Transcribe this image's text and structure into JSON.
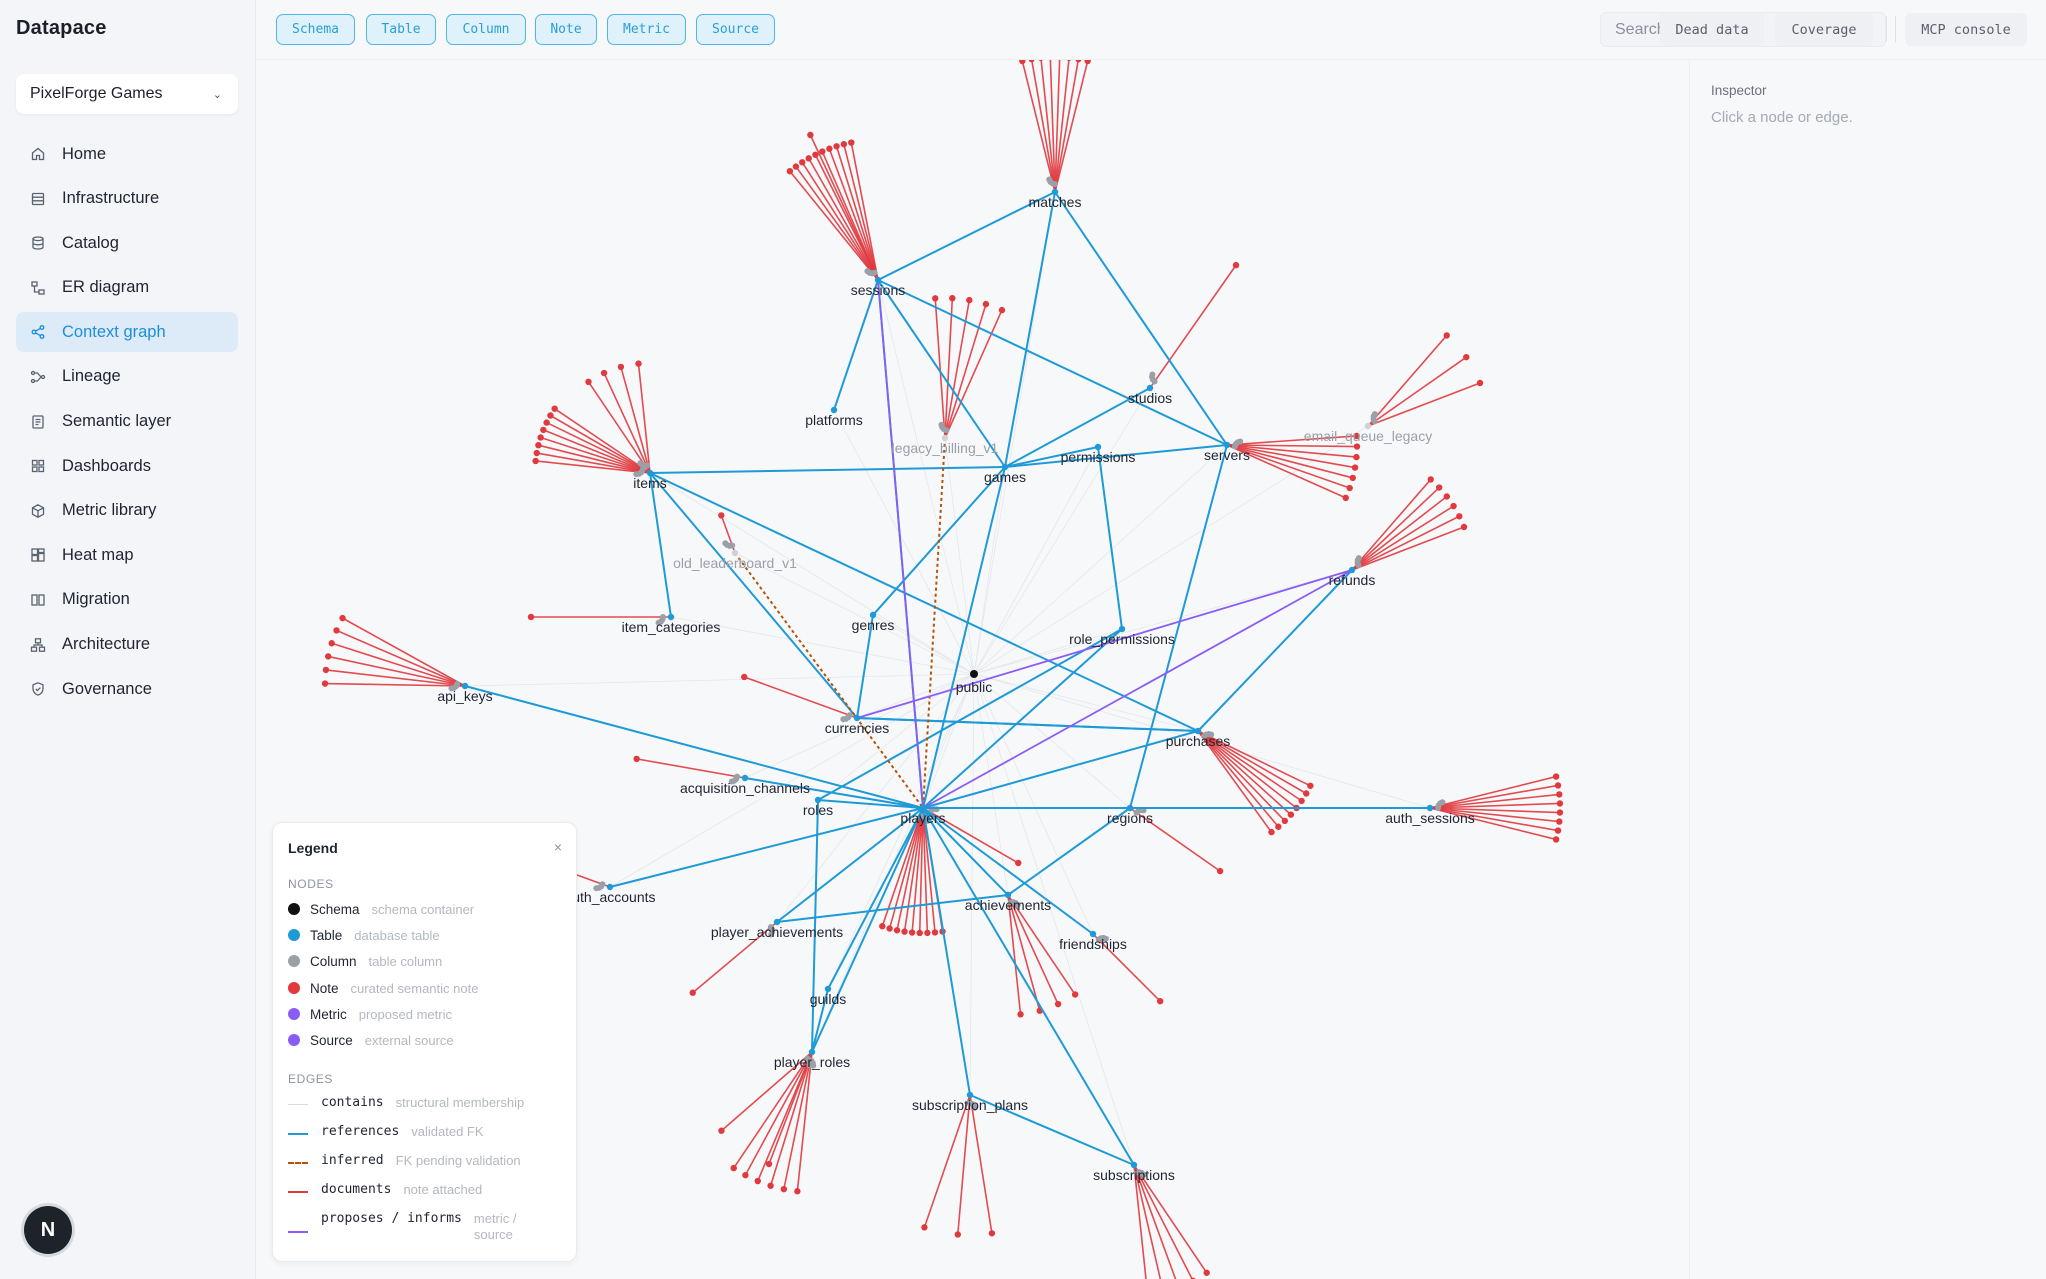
{
  "app": {
    "name": "Datapace"
  },
  "org_selector": {
    "value": "PixelForge Games"
  },
  "sidebar": {
    "items": [
      {
        "label": "Home",
        "icon": "home-icon"
      },
      {
        "label": "Infrastructure",
        "icon": "server-icon"
      },
      {
        "label": "Catalog",
        "icon": "database-icon"
      },
      {
        "label": "ER diagram",
        "icon": "er-diagram-icon"
      },
      {
        "label": "Context graph",
        "icon": "share-icon",
        "active": true
      },
      {
        "label": "Lineage",
        "icon": "lineage-icon"
      },
      {
        "label": "Semantic layer",
        "icon": "document-icon"
      },
      {
        "label": "Dashboards",
        "icon": "grid-icon"
      },
      {
        "label": "Metric library",
        "icon": "cube-icon"
      },
      {
        "label": "Heat map",
        "icon": "heatmap-icon"
      },
      {
        "label": "Migration",
        "icon": "columns-icon"
      },
      {
        "label": "Architecture",
        "icon": "hierarchy-icon"
      },
      {
        "label": "Governance",
        "icon": "shield-icon"
      }
    ]
  },
  "user": {
    "initial": "N"
  },
  "filters": [
    "Schema",
    "Table",
    "Column",
    "Note",
    "Metric",
    "Source"
  ],
  "search": {
    "placeholder": "Search..."
  },
  "toolbar": {
    "dead_data": "Dead data",
    "coverage": "Coverage",
    "mcp_console": "MCP console"
  },
  "inspector": {
    "title": "Inspector",
    "hint": "Click a node or edge."
  },
  "colors": {
    "accent": "#1d8fd8",
    "table": "#1e9ad6",
    "note": "#e0393e",
    "metric": "#8a5cf6",
    "inferred": "#b45309",
    "column": "#9aa0a8",
    "schema": "#111111"
  },
  "graph": {
    "schema_label": "public",
    "tables": [
      "matches",
      "sessions",
      "platforms",
      "legacy_billing_v1",
      "studios",
      "permissions",
      "servers",
      "email_queue_legacy",
      "games",
      "items",
      "old_leaderboard_v1",
      "refunds",
      "item_categories",
      "genres",
      "role_permissions",
      "api_keys",
      "currencies",
      "purchases",
      "acquisition_channels",
      "roles",
      "players",
      "regions",
      "auth_sessions",
      "auth_accounts",
      "achievements",
      "player_achievements",
      "friendships",
      "guilds",
      "player_roles",
      "subscription_plans",
      "subscriptions"
    ]
  },
  "legend": {
    "title": "Legend",
    "nodes_heading": "NODES",
    "nodes": [
      {
        "label": "Schema",
        "desc": "schema container",
        "color": "#111111"
      },
      {
        "label": "Table",
        "desc": "database table",
        "color": "#1e9ad6"
      },
      {
        "label": "Column",
        "desc": "table column",
        "color": "#9aa0a8"
      },
      {
        "label": "Note",
        "desc": "curated semantic note",
        "color": "#e0393e"
      },
      {
        "label": "Metric",
        "desc": "proposed metric",
        "color": "#8a5cf6"
      },
      {
        "label": "Source",
        "desc": "external source",
        "color": "#8a5cf6"
      }
    ],
    "edges_heading": "EDGES",
    "edges": [
      {
        "label": "contains",
        "desc": "structural membership"
      },
      {
        "label": "references",
        "desc": "validated FK"
      },
      {
        "label": "inferred",
        "desc": "FK pending validation"
      },
      {
        "label": "documents",
        "desc": "note attached"
      },
      {
        "label": "proposes / informs",
        "desc": "metric / source"
      }
    ]
  }
}
